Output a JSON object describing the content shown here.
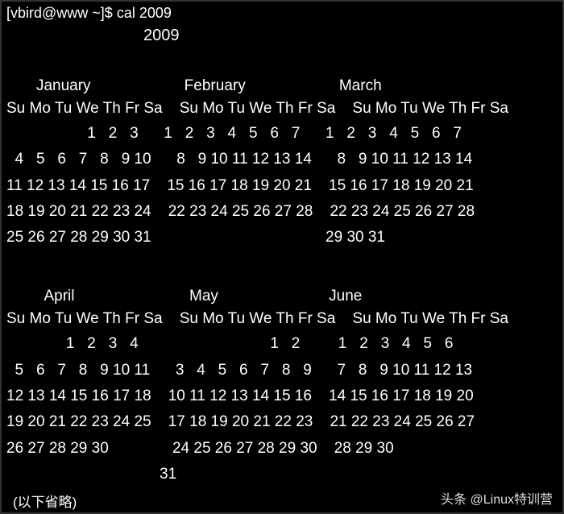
{
  "prompt": {
    "user_host": "[vbird@www ~]$",
    "command": "cal 2009"
  },
  "year": "2009",
  "day_header": "Su Mo Tu We Th Fr Sa    Su Mo Tu We Th Fr Sa    Su Mo Tu We Th Fr Sa",
  "rows": [
    {
      "month_labels": "       January                      February                      March",
      "weeks": [
        "                   1   2   3      1   2   3   4   5   6   7      1   2   3   4   5   6   7",
        "  4   5   6   7   8   9 10      8   9 10 11 12 13 14      8   9 10 11 12 13 14",
        "11 12 13 14 15 16 17    15 16 17 18 19 20 21    15 16 17 18 19 20 21",
        "18 19 20 21 22 23 24    22 23 24 25 26 27 28    22 23 24 25 26 27 28",
        "25 26 27 28 29 30 31                                         29 30 31"
      ]
    },
    {
      "month_labels": "         April                           May                          June",
      "weeks": [
        "              1   2   3   4                               1   2         1   2   3   4   5   6",
        "  5   6   7   8   9 10 11      3   4   5   6   7   8   9      7   8   9 10 11 12 13",
        "12 13 14 15 16 17 18    10 11 12 13 14 15 16    14 15 16 17 18 19 20",
        "19 20 21 22 23 24 25    17 18 19 20 21 22 23    21 22 23 24 25 26 27",
        "26 27 28 29 30               24 25 26 27 28 29 30    28 29 30",
        "                                    31"
      ]
    }
  ],
  "truncated_note": "(以下省略)",
  "watermark": "头条 @Linux特训营",
  "chart_data": {
    "type": "table",
    "title": "cal 2009 output (first two rows of months)",
    "months": [
      {
        "name": "January",
        "year": 2009,
        "first_weekday": "Th",
        "days": 31,
        "grid": [
          [
            null,
            null,
            null,
            null,
            1,
            2,
            3
          ],
          [
            4,
            5,
            6,
            7,
            8,
            9,
            10
          ],
          [
            11,
            12,
            13,
            14,
            15,
            16,
            17
          ],
          [
            18,
            19,
            20,
            21,
            22,
            23,
            24
          ],
          [
            25,
            26,
            27,
            28,
            29,
            30,
            31
          ]
        ]
      },
      {
        "name": "February",
        "year": 2009,
        "first_weekday": "Su",
        "days": 28,
        "grid": [
          [
            1,
            2,
            3,
            4,
            5,
            6,
            7
          ],
          [
            8,
            9,
            10,
            11,
            12,
            13,
            14
          ],
          [
            15,
            16,
            17,
            18,
            19,
            20,
            21
          ],
          [
            22,
            23,
            24,
            25,
            26,
            27,
            28
          ]
        ]
      },
      {
        "name": "March",
        "year": 2009,
        "first_weekday": "Su",
        "days": 31,
        "grid": [
          [
            1,
            2,
            3,
            4,
            5,
            6,
            7
          ],
          [
            8,
            9,
            10,
            11,
            12,
            13,
            14
          ],
          [
            15,
            16,
            17,
            18,
            19,
            20,
            21
          ],
          [
            22,
            23,
            24,
            25,
            26,
            27,
            28
          ],
          [
            29,
            30,
            31,
            null,
            null,
            null,
            null
          ]
        ]
      },
      {
        "name": "April",
        "year": 2009,
        "first_weekday": "We",
        "days": 30,
        "grid": [
          [
            null,
            null,
            null,
            1,
            2,
            3,
            4
          ],
          [
            5,
            6,
            7,
            8,
            9,
            10,
            11
          ],
          [
            12,
            13,
            14,
            15,
            16,
            17,
            18
          ],
          [
            19,
            20,
            21,
            22,
            23,
            24,
            25
          ],
          [
            26,
            27,
            28,
            29,
            30,
            null,
            null
          ]
        ]
      },
      {
        "name": "May",
        "year": 2009,
        "first_weekday": "Fr",
        "days": 31,
        "grid": [
          [
            null,
            null,
            null,
            null,
            null,
            1,
            2
          ],
          [
            3,
            4,
            5,
            6,
            7,
            8,
            9
          ],
          [
            10,
            11,
            12,
            13,
            14,
            15,
            16
          ],
          [
            17,
            18,
            19,
            20,
            21,
            22,
            23
          ],
          [
            24,
            25,
            26,
            27,
            28,
            29,
            30
          ],
          [
            31,
            null,
            null,
            null,
            null,
            null,
            null
          ]
        ]
      },
      {
        "name": "June",
        "year": 2009,
        "first_weekday": "Mo",
        "days": 30,
        "grid": [
          [
            null,
            1,
            2,
            3,
            4,
            5,
            6
          ],
          [
            7,
            8,
            9,
            10,
            11,
            12,
            13
          ],
          [
            14,
            15,
            16,
            17,
            18,
            19,
            20
          ],
          [
            21,
            22,
            23,
            24,
            25,
            26,
            27
          ],
          [
            28,
            29,
            30,
            null,
            null,
            null,
            null
          ]
        ]
      }
    ]
  }
}
